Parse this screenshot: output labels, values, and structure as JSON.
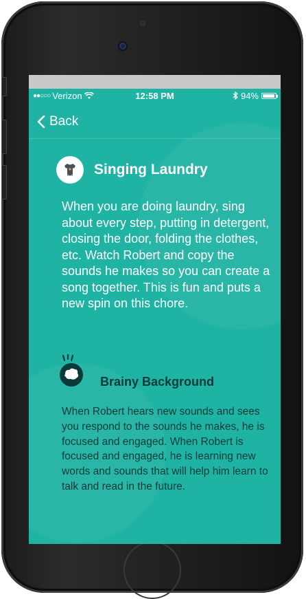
{
  "status_bar": {
    "carrier": "Verizon",
    "time": "12:58 PM",
    "battery": "94%",
    "battery_level": 0.94
  },
  "nav": {
    "back_label": "Back"
  },
  "activity": {
    "title": "Singing Laundry",
    "icon": "baby-onesie-icon",
    "description": "When you are doing laundry, sing about every step, putting in detergent, closing the door, folding the clothes, etc. Watch Robert and copy the sounds he makes so you can create a song together. This is fun and puts a new spin on this chore."
  },
  "background_info": {
    "title": "Brainy Background",
    "icon": "brain-icon",
    "description": "When Robert hears new sounds and sees you respond to the sounds he makes, he is focused and engaged. When Robert is focused and engaged, he is learning new words and sounds that will help him learn to talk and read in the future."
  },
  "colors": {
    "screen_bg": "#1fb3a3",
    "dark_text": "#0b3b39",
    "light_text": "#ffffff"
  }
}
